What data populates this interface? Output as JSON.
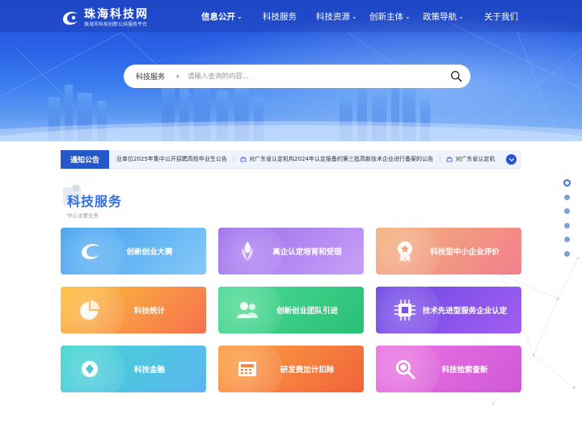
{
  "site": {
    "title": "珠海科技网",
    "subtitle": "珠海市科技创新公共服务平台"
  },
  "nav": [
    {
      "label": "信息公开",
      "has_dropdown": true,
      "active": true
    },
    {
      "label": "科技服务",
      "has_dropdown": false,
      "active": false
    },
    {
      "label": "科技资源",
      "has_dropdown": true,
      "active": false
    },
    {
      "label": "创新主体",
      "has_dropdown": true,
      "active": false
    },
    {
      "label": "政策导航",
      "has_dropdown": true,
      "active": false
    },
    {
      "label": "关于我们",
      "has_dropdown": false,
      "active": false
    }
  ],
  "search": {
    "type_selected": "科技服务",
    "placeholder": "请输入查询的内容...",
    "button_icon": "search-icon"
  },
  "notice": {
    "label": "通知公告",
    "items": [
      "事业单位2025年集中公开招聘高校毕业生公告",
      "对广东省认定机构2024年认定报备的第三批高新技术企业进行备案的公告",
      "对广东省认定机"
    ],
    "more_icon": "chevron-down-icon"
  },
  "section": {
    "title": "科技服务",
    "subtitle": "中心主要业务"
  },
  "cards": [
    {
      "label": "创新创业大赛",
      "icon": "swoosh-icon",
      "gradient": [
        "#4aa8f2",
        "#7fc5f7"
      ]
    },
    {
      "label": "高企认定培育和受理",
      "icon": "torch-icon",
      "gradient": [
        "#a77bef",
        "#c79cf5"
      ]
    },
    {
      "label": "科技型中小企业评价",
      "icon": "medal-icon",
      "gradient": [
        "#f2b07c",
        "#f48a8a"
      ]
    },
    {
      "label": "科技统计",
      "icon": "pie-chart-icon",
      "gradient": [
        "#fbb73b",
        "#f7784f"
      ]
    },
    {
      "label": "创新创业团队引进",
      "icon": "team-icon",
      "gradient": [
        "#3fd58e",
        "#2fc27a"
      ]
    },
    {
      "label": "技术先进型服务企业认定",
      "icon": "chip-icon",
      "gradient": [
        "#7a4de6",
        "#9d5cf0"
      ]
    },
    {
      "label": "科技金融",
      "icon": "coin-icon",
      "gradient": [
        "#41d4d0",
        "#59b8f1"
      ]
    },
    {
      "label": "研发费加计扣除",
      "icon": "calculator-icon",
      "gradient": [
        "#fb9d3e",
        "#f36a3b"
      ]
    },
    {
      "label": "科技检索查新",
      "icon": "magnifier-icon",
      "gradient": [
        "#e56be0",
        "#d45bdc"
      ]
    }
  ],
  "pager": {
    "count": 6,
    "active_index": 0
  },
  "colors": {
    "primary": "#2457c8",
    "title_blue": "#2f6fe3"
  }
}
